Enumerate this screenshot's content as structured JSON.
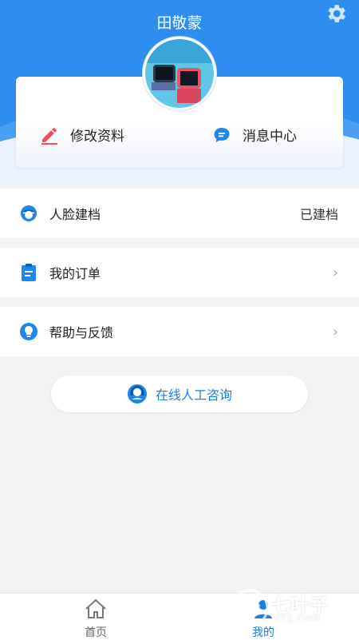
{
  "user": {
    "name": "田敬蒙"
  },
  "icons": {
    "settings": "gear-icon",
    "edit": "pencil-icon",
    "message": "chat-bubble-icon",
    "face": "face-profile-icon",
    "order": "clipboard-icon",
    "help": "lightbulb-icon",
    "consult": "headset-agent-icon",
    "home": "house-icon",
    "me": "person-icon"
  },
  "card": {
    "edit_label": "修改资料",
    "message_label": "消息中心"
  },
  "menu": [
    {
      "label": "人脸建档",
      "status": "已建档"
    },
    {
      "label": "我的订单",
      "status": ""
    },
    {
      "label": "帮助与反馈",
      "status": ""
    }
  ],
  "consult": {
    "label": "在线人工咨询"
  },
  "tabbar": {
    "home_label": "首页",
    "me_label": "我的"
  },
  "watermark": {
    "title": "七叶子",
    "site": "7YZ.COM"
  },
  "colors": {
    "primary": "#2e8ef0",
    "accent": "#1f7fe0",
    "edit_icon": "#f04f5a"
  }
}
